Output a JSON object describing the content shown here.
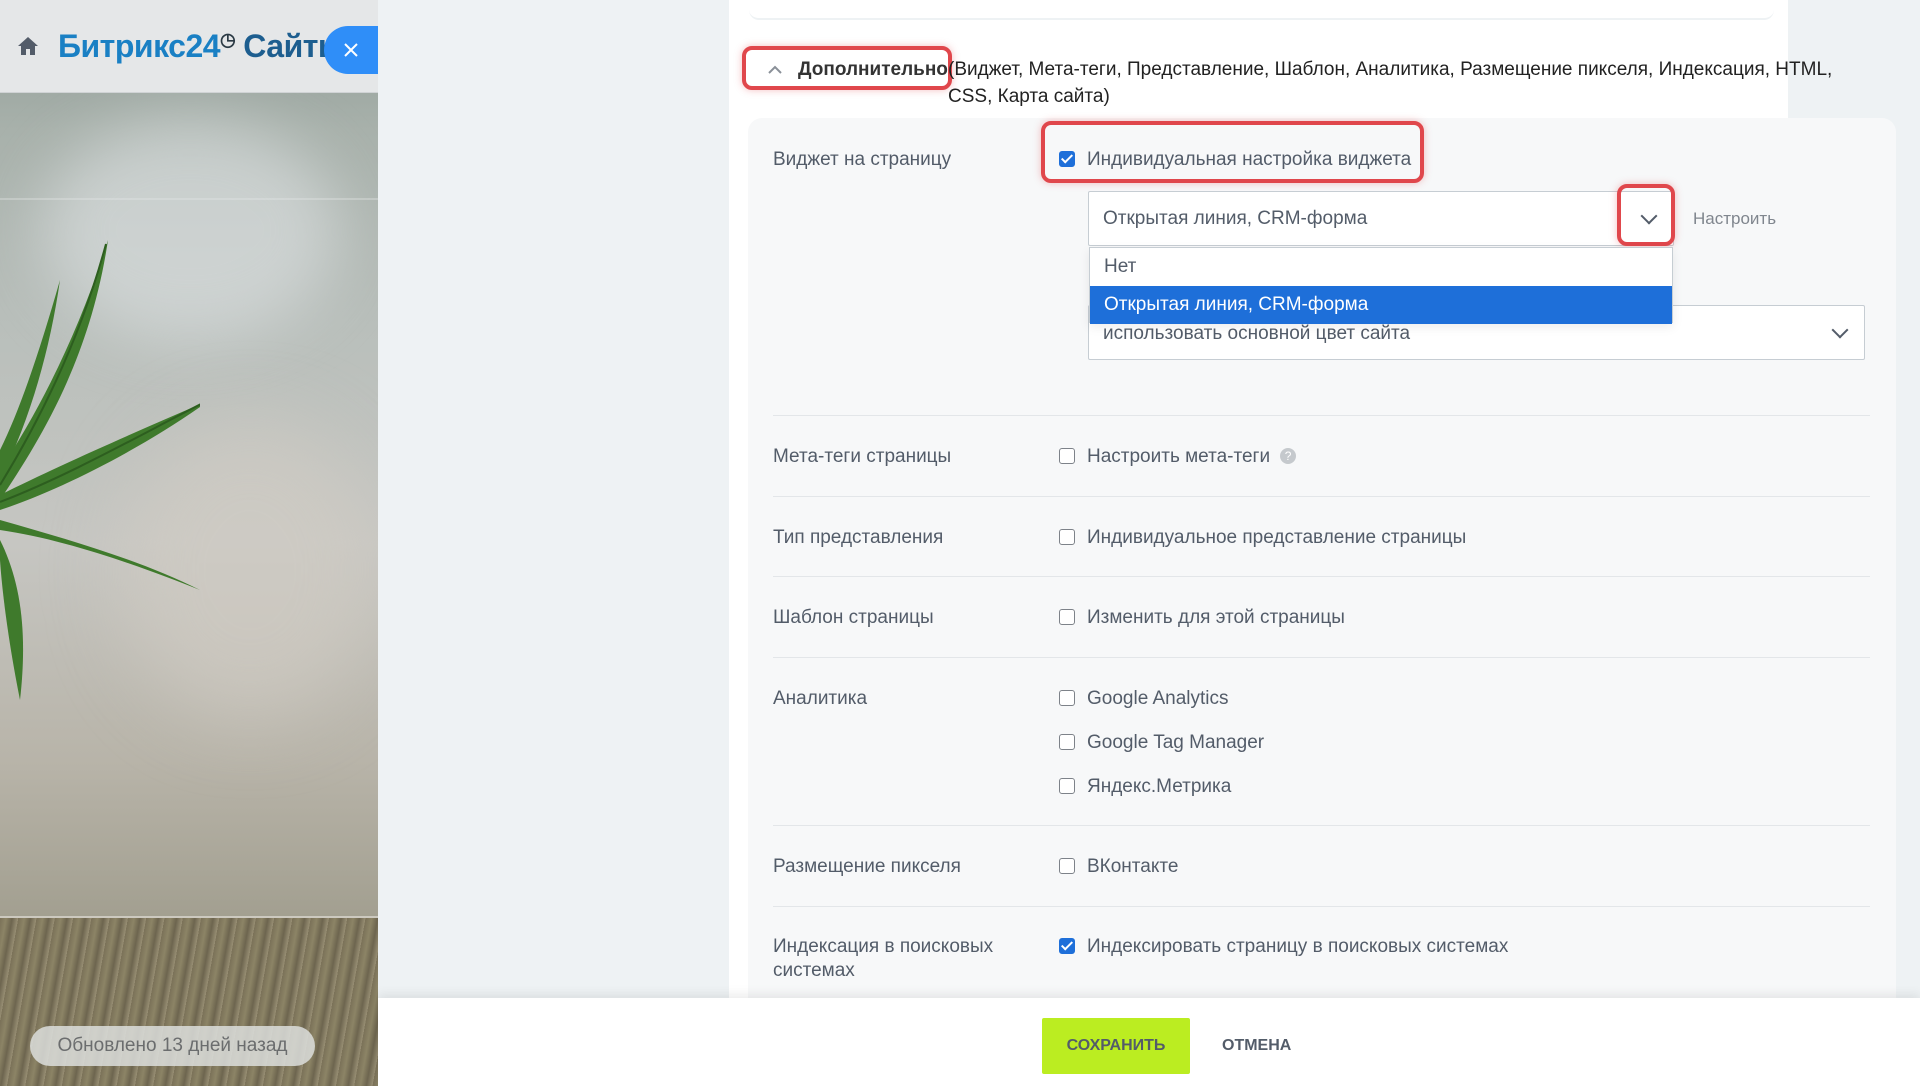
{
  "left": {
    "brand": "Битрикс24",
    "brand_suffix": "Сайты",
    "updated_label": "Обновлено 13 дней назад"
  },
  "more_section": {
    "toggle_label": "Дополнительно",
    "summary": "(Виджет, Мета-теги, Представление, Шаблон, Аналитика, Размещение пикселя, Индексация, HTML, CSS, Карта сайта)"
  },
  "widget": {
    "row_label": "Виджет на страницу",
    "checkbox_label": "Индивидуальная настройка виджета",
    "checkbox_checked": true,
    "select_value": "Открытая линия, CRM-форма",
    "setup_label": "Настроить",
    "options": [
      "Нет",
      "Открытая линия, CRM-форма"
    ],
    "selected_option": "Открытая линия, CRM-форма",
    "color_select_value": "использовать основной цвет сайта"
  },
  "meta": {
    "row_label": "Мета-теги страницы",
    "checkbox_label": "Настроить мета-теги",
    "checkbox_checked": false
  },
  "view": {
    "row_label": "Тип представления",
    "checkbox_label": "Индивидуальное представление страницы",
    "checkbox_checked": false
  },
  "template": {
    "row_label": "Шаблон страницы",
    "checkbox_label": "Изменить для этой страницы",
    "checkbox_checked": false
  },
  "analytics": {
    "row_label": "Аналитика",
    "items": [
      {
        "label": "Google Analytics",
        "checked": false
      },
      {
        "label": "Google Tag Manager",
        "checked": false
      },
      {
        "label": "Яндекс.Метрика",
        "checked": false
      }
    ]
  },
  "pixel": {
    "row_label": "Размещение пикселя",
    "checkbox_label": "ВКонтакте",
    "checkbox_checked": false
  },
  "indexing": {
    "row_label": "Индексация в поисковых системах",
    "checkbox_label": "Индексировать страницу в поисковых системах",
    "checkbox_checked": true
  },
  "footer": {
    "save_label": "СОХРАНИТЬ",
    "cancel_label": "ОТМЕНА"
  },
  "colors": {
    "accent": "#1e6fd9",
    "save": "#bbed21",
    "highlight": "#e0474c",
    "close": "#2f8ef8"
  }
}
